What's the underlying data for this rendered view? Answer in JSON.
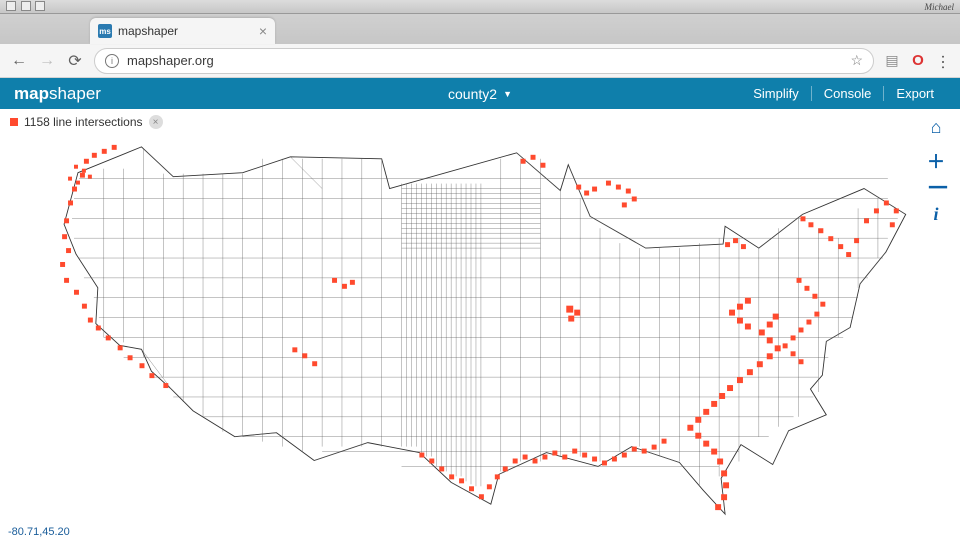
{
  "os": {
    "user": "Michael"
  },
  "browser": {
    "tab_title": "mapshaper",
    "favicon_label": "ms",
    "url": "mapshaper.org"
  },
  "app": {
    "logo_bold": "map",
    "logo_light": "shaper",
    "layer": "county2",
    "actions": {
      "simplify": "Simplify",
      "console": "Console",
      "export": "Export"
    }
  },
  "status": {
    "count": 1158,
    "text": "1158 line intersections"
  },
  "coords": "-80.71,45.20"
}
